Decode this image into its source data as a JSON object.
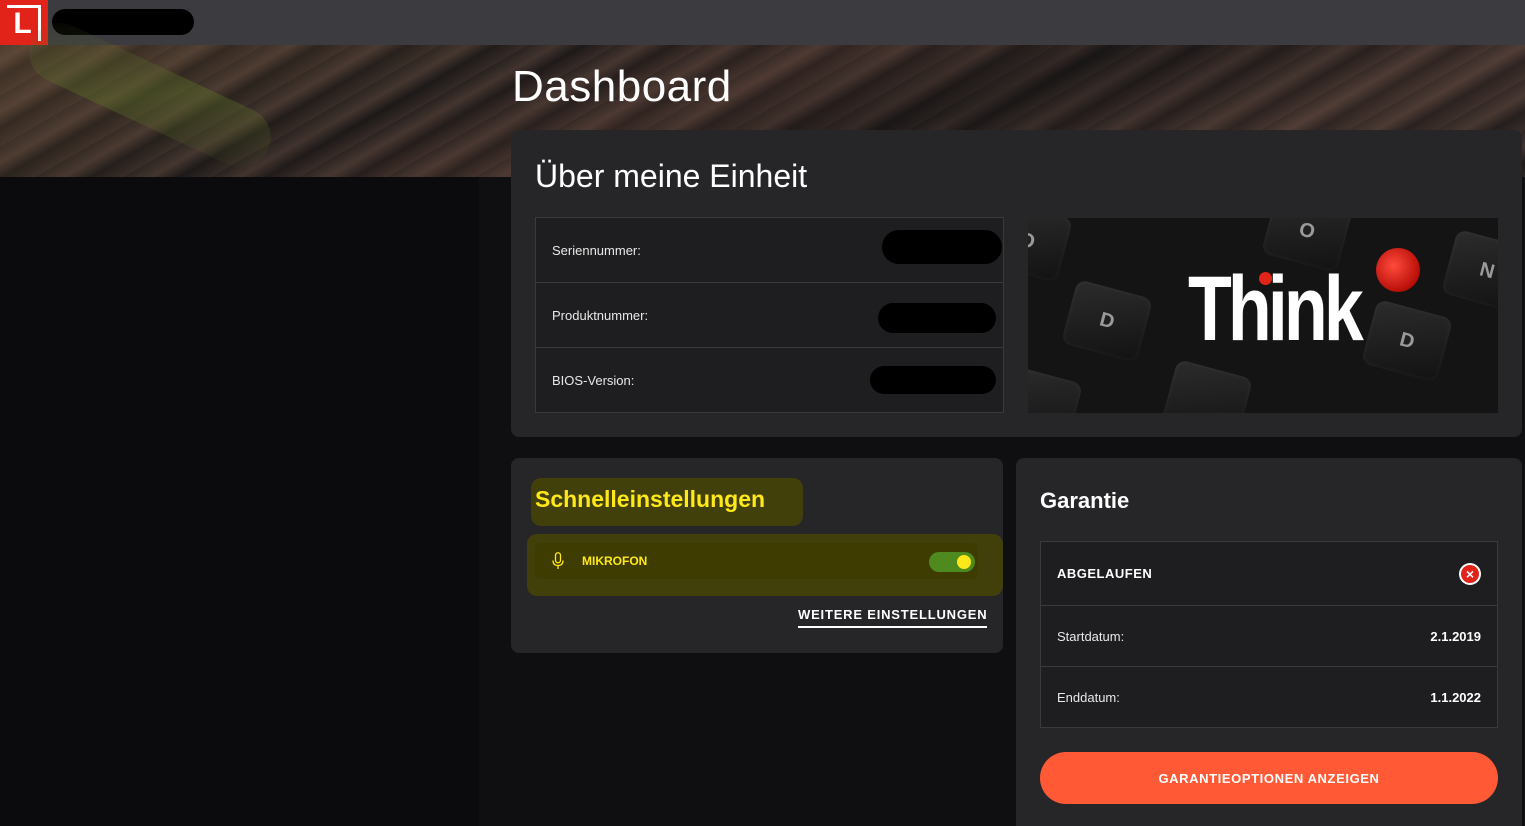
{
  "app": {
    "logo_letter": "L",
    "brand_color": "#e2231a"
  },
  "page": {
    "title": "Dashboard"
  },
  "about": {
    "title": "Über meine Einheit",
    "rows": [
      {
        "label": "Seriennummer:",
        "value": ""
      },
      {
        "label": "Produktnummer:",
        "value": ""
      },
      {
        "label": "BIOS-Version:",
        "value": ""
      }
    ],
    "image_text": "Think",
    "image_keys": [
      "O",
      "D",
      "D",
      "O",
      "N"
    ]
  },
  "quick": {
    "title": "Schnelleinstellungen",
    "mic_label": "MIKROFON",
    "mic_enabled": true,
    "more_link": "WEITERE EINSTELLUNGEN",
    "highlight_color": "#ffe81a"
  },
  "warranty": {
    "title": "Garantie",
    "status": "ABGELAUFEN",
    "rows": [
      {
        "label": "Startdatum:",
        "value": "2.1.2019"
      },
      {
        "label": "Enddatum:",
        "value": "1.1.2022"
      }
    ],
    "button": "GARANTIEOPTIONEN ANZEIGEN",
    "button_color": "#ff5a35"
  }
}
